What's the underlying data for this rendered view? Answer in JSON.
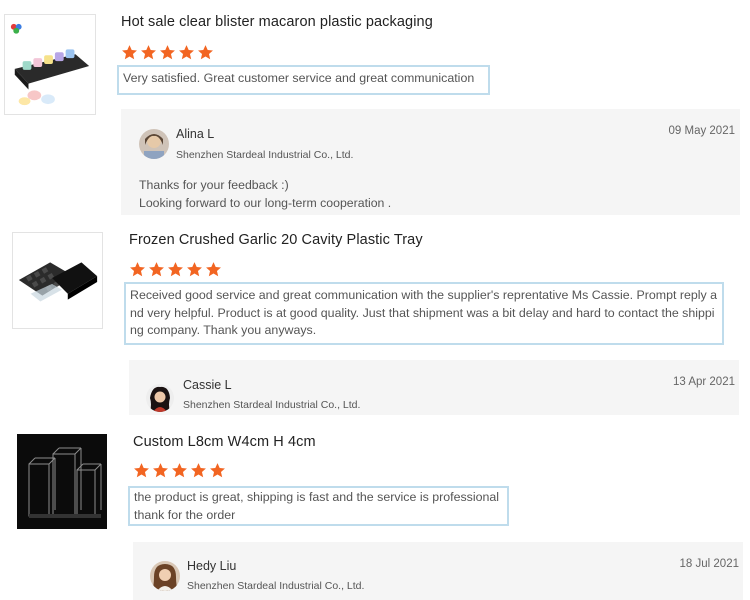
{
  "reviews": [
    {
      "title": "Hot sale clear blister macaron plastic packaging",
      "rating": 5,
      "comment_lines": [
        "Very satisfied.  Great customer service and great communication"
      ],
      "product_icon": "macaron-packaging-image",
      "reply": {
        "name": "Alina L",
        "company": "Shenzhen Stardeal Industrial Co., Ltd.",
        "date": "09 May 2021",
        "text_lines": [
          "Thanks for your feedback :)",
          "Looking forward to our long-term cooperation ."
        ]
      }
    },
    {
      "title": "Frozen Crushed Garlic 20 Cavity Plastic Tray",
      "rating": 5,
      "comment_lines": [
        "Received good service and great communication with the supplier's reprentative Ms Cassie. Prompt reply a",
        "nd very helpful. Product is at good quality. Just that shipment was a bit delay and hard to contact the shippi",
        "ng company. Thank you anyways."
      ],
      "product_icon": "plastic-tray-image",
      "reply": {
        "name": "Cassie L",
        "company": "Shenzhen Stardeal Industrial Co., Ltd.",
        "date": "13 Apr 2021",
        "text_lines": []
      }
    },
    {
      "title": "Custom L8cm W4cm H 4cm",
      "rating": 5,
      "comment_lines": [
        "the product is great, shipping is fast and the service is professional",
        "thank for the order"
      ],
      "product_icon": "clear-box-image",
      "reply": {
        "name": "Hedy Liu",
        "company": "Shenzhen Stardeal Industrial Co., Ltd.",
        "date": "18 Jul 2021",
        "text_lines": []
      }
    }
  ],
  "colors": {
    "star": "#f26522",
    "comment_border": "#bfdcec",
    "reply_bg": "#f5f5f5"
  }
}
